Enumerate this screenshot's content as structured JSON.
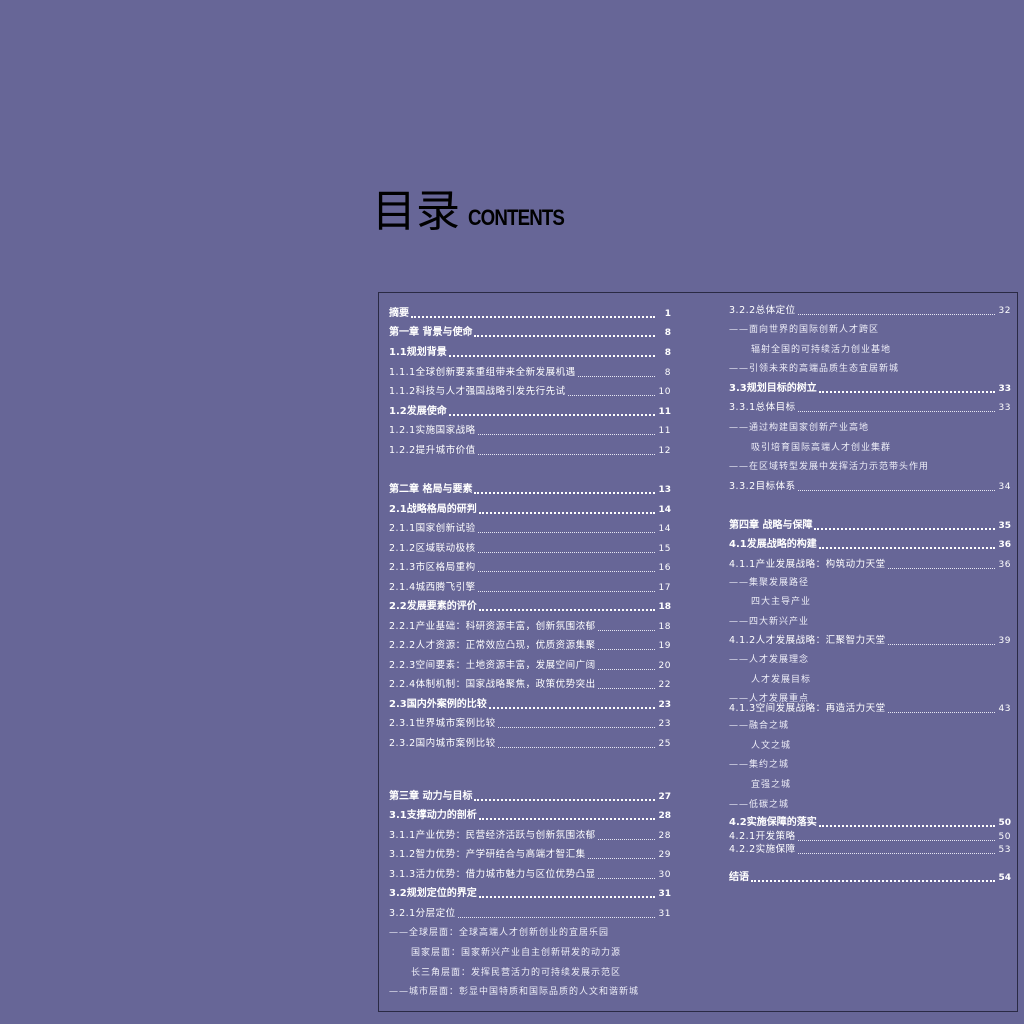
{
  "title": {
    "cn": "目录",
    "en": "CONTENTS"
  },
  "left_column": [
    {
      "text": "摘要",
      "page": "1",
      "style": "bold"
    },
    {
      "text": "第一章  背景与使命",
      "page": "8",
      "style": "bold"
    },
    {
      "text": "1.1规划背景",
      "page": "8",
      "style": "bold"
    },
    {
      "text": "1.1.1全球创新要素重组带来全新发展机遇",
      "page": "8",
      "style": "sub"
    },
    {
      "text": "1.1.2科技与人才强国战略引发先行先试",
      "page": "10",
      "style": "sub"
    },
    {
      "text": "1.2发展使命",
      "page": "11",
      "style": "bold"
    },
    {
      "text": "1.2.1实施国家战略",
      "page": "11",
      "style": "sub"
    },
    {
      "text": "1.2.2提升城市价值",
      "page": "12",
      "style": "sub"
    },
    {
      "text": "第二章  格局与要素",
      "page": "13",
      "style": "bold"
    },
    {
      "text": "2.1战略格局的研判",
      "page": "14",
      "style": "bold"
    },
    {
      "text": "2.1.1国家创新试验",
      "page": "14",
      "style": "sub"
    },
    {
      "text": "2.1.2区域联动极核",
      "page": "15",
      "style": "sub"
    },
    {
      "text": "2.1.3市区格局重构",
      "page": "16",
      "style": "sub"
    },
    {
      "text": "2.1.4城西腾飞引擎",
      "page": "17",
      "style": "sub"
    },
    {
      "text": "2.2发展要素的评价",
      "page": "18",
      "style": "bold"
    },
    {
      "text": "2.2.1产业基础：科研资源丰富，创新氛围浓郁",
      "page": "18",
      "style": "sub"
    },
    {
      "text": "2.2.2人才资源：正常效应凸现，优质资源集聚",
      "page": "19",
      "style": "sub"
    },
    {
      "text": "2.2.3空间要素：土地资源丰富，发展空间广阔",
      "page": "20",
      "style": "sub"
    },
    {
      "text": "2.2.4体制机制：国家战略聚焦，政策优势突出",
      "page": "22",
      "style": "sub"
    },
    {
      "text": "2.3国内外案例的比较",
      "page": "23",
      "style": "bold"
    },
    {
      "text": "2.3.1世界城市案例比较",
      "page": "23",
      "style": "sub"
    },
    {
      "text": "2.3.2国内城市案例比较",
      "page": "25",
      "style": "sub"
    },
    {
      "text": "第三章  动力与目标",
      "page": "27",
      "style": "bold"
    },
    {
      "text": "3.1支撑动力的剖析",
      "page": "28",
      "style": "bold"
    },
    {
      "text": "3.1.1产业优势：民营经济活跃与创新氛围浓郁",
      "page": "28",
      "style": "sub"
    },
    {
      "text": "3.1.2智力优势：产学研结合与高端才智汇集",
      "page": "29",
      "style": "sub"
    },
    {
      "text": "3.1.3活力优势：借力城市魅力与区位优势凸显",
      "page": "30",
      "style": "sub"
    },
    {
      "text": "3.2规划定位的界定",
      "page": "31",
      "style": "bold"
    },
    {
      "text": "3.2.1分层定位",
      "page": "31",
      "style": "sub"
    },
    {
      "text": "——全球层面：全球高端人才创新创业的宜居乐园",
      "page": "",
      "style": "plain"
    },
    {
      "text": "国家层面：国家新兴产业自主创新研发的动力源",
      "page": "",
      "style": "plain-ind"
    },
    {
      "text": "长三角层面：发挥民营活力的可持续发展示范区",
      "page": "",
      "style": "plain-ind"
    },
    {
      "text": "——城市层面：彰显中国特质和国际品质的人文和谐新城",
      "page": "",
      "style": "plain"
    }
  ],
  "right_column": [
    {
      "text": "3.2.2总体定位",
      "page": "32",
      "style": "sub"
    },
    {
      "text": "——面向世界的国际创新人才跨区",
      "page": "",
      "style": "plain"
    },
    {
      "text": "辐射全国的可持续活力创业基地",
      "page": "",
      "style": "plain-ind"
    },
    {
      "text": "——引领未来的高端品质生态宜居新城",
      "page": "",
      "style": "plain"
    },
    {
      "text": "3.3规划目标的树立",
      "page": "33",
      "style": "bold"
    },
    {
      "text": "3.3.1总体目标",
      "page": "33",
      "style": "sub"
    },
    {
      "text": "——通过构建国家创新产业高地",
      "page": "",
      "style": "plain"
    },
    {
      "text": "吸引培育国际高端人才创业集群",
      "page": "",
      "style": "plain-ind"
    },
    {
      "text": "——在区域转型发展中发挥活力示范带头作用",
      "page": "",
      "style": "plain"
    },
    {
      "text": "3.3.2目标体系",
      "page": "34",
      "style": "sub"
    },
    {
      "text": "第四章  战略与保障",
      "page": "35",
      "style": "bold"
    },
    {
      "text": "4.1发展战略的构建",
      "page": "36",
      "style": "bold"
    },
    {
      "text": "4.1.1产业发展战略：构筑动力天堂",
      "page": "36",
      "style": "sub"
    },
    {
      "text": "——集聚发展路径",
      "page": "",
      "style": "plain"
    },
    {
      "text": "四大主导产业",
      "page": "",
      "style": "plain-ind"
    },
    {
      "text": "——四大新兴产业",
      "page": "",
      "style": "plain"
    },
    {
      "text": "4.1.2人才发展战略：汇聚智力天堂",
      "page": "39",
      "style": "sub"
    },
    {
      "text": "——人才发展理念",
      "page": "",
      "style": "plain"
    },
    {
      "text": "人才发展目标",
      "page": "",
      "style": "plain-ind"
    },
    {
      "text": "——人才发展重点",
      "page": "",
      "style": "plain"
    },
    {
      "text": "4.1.3空间发展战略：再造活力天堂",
      "page": "43",
      "style": "sub"
    },
    {
      "text": "——融合之城",
      "page": "",
      "style": "plain"
    },
    {
      "text": "人文之城",
      "page": "",
      "style": "plain-ind"
    },
    {
      "text": "——集约之城",
      "page": "",
      "style": "plain"
    },
    {
      "text": "宜强之城",
      "page": "",
      "style": "plain-ind"
    },
    {
      "text": "——低碳之城",
      "page": "",
      "style": "plain"
    },
    {
      "text": "4.2实施保障的落实",
      "page": "50",
      "style": "bold"
    },
    {
      "text": "4.2.1开发策略",
      "page": "50",
      "style": "sub"
    },
    {
      "text": "4.2.2实施保障",
      "page": "53",
      "style": "sub"
    },
    {
      "text": "结语",
      "page": "54",
      "style": "bold"
    }
  ]
}
